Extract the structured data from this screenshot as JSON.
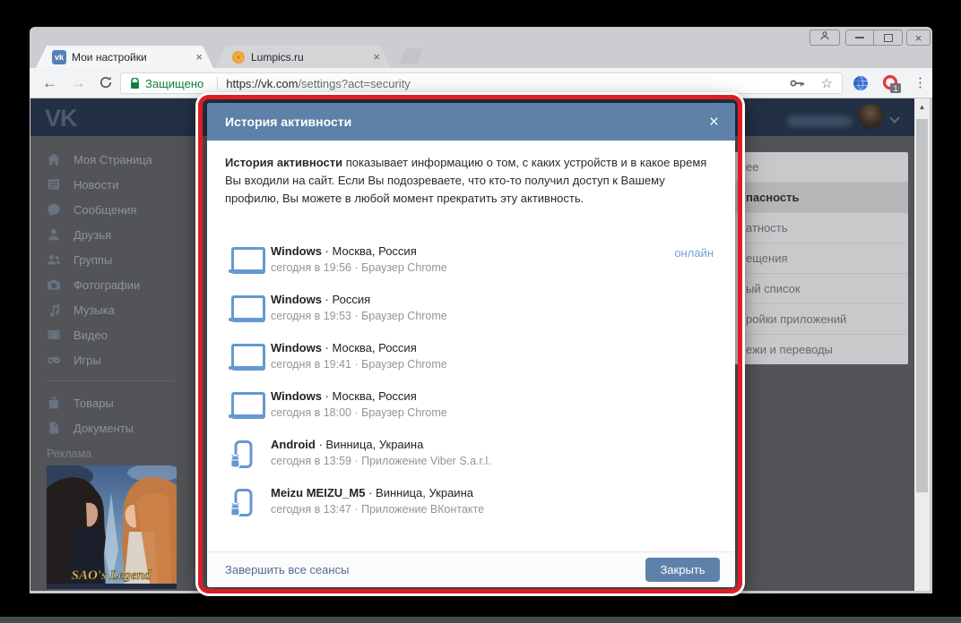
{
  "browser": {
    "tabs": [
      {
        "title": "Мои настройки",
        "favicon": "vk"
      },
      {
        "title": "Lumpics.ru",
        "favicon": "lumpics"
      }
    ],
    "security_label": "Защищено",
    "url_host": "https://vk.com",
    "url_path": "/settings?act=security",
    "extension_badge": "1"
  },
  "icons": {
    "back": "←",
    "forward": "→",
    "star": "☆",
    "menu_dots": "⋮",
    "tab_close": "×",
    "modal_close": "×",
    "window_close": "×",
    "scroll_up": "▲",
    "vk_favicon_text": "vk"
  },
  "vk": {
    "logo": "VK",
    "sidebar": [
      {
        "label": "Моя Страница"
      },
      {
        "label": "Новости"
      },
      {
        "label": "Сообщения"
      },
      {
        "label": "Друзья"
      },
      {
        "label": "Группы"
      },
      {
        "label": "Фотографии"
      },
      {
        "label": "Музыка"
      },
      {
        "label": "Видео"
      },
      {
        "label": "Игры"
      },
      {
        "label": "Товары"
      },
      {
        "label": "Документы"
      }
    ],
    "ads_label": "Реклама",
    "ad_title": "SAO's Legend",
    "settings_menu_visible": [
      {
        "label": "ее",
        "selected": false
      },
      {
        "label": "пасность",
        "selected": true
      },
      {
        "label": "атность",
        "selected": false
      },
      {
        "label": "ещения",
        "selected": false
      },
      {
        "label": "ый список",
        "selected": false
      },
      {
        "label": "ройки приложений",
        "selected": false
      },
      {
        "label": "ежи и переводы",
        "selected": false
      }
    ]
  },
  "modal": {
    "title": "История активности",
    "intro_bold": "История активности",
    "intro_text": " показывает информацию о том, с каких устройств и в какое время Вы входили на сайт. Если Вы подозреваете, что кто-то получил доступ к Вашему профилю, Вы можете в любой момент прекратить эту активность.",
    "separator": " · ",
    "sessions": [
      {
        "device": "Windows",
        "location": "Москва, Россия",
        "details": "сегодня в 19:56 · Браузер Chrome",
        "icon": "laptop",
        "status": "онлайн"
      },
      {
        "device": "Windows",
        "location": "Россия",
        "details": "сегодня в 19:53 · Браузер Chrome",
        "icon": "laptop",
        "status": ""
      },
      {
        "device": "Windows",
        "location": "Москва, Россия",
        "details": "сегодня в 19:41 · Браузер Chrome",
        "icon": "laptop",
        "status": ""
      },
      {
        "device": "Windows",
        "location": "Москва, Россия",
        "details": "сегодня в 18:00 · Браузер Chrome",
        "icon": "laptop",
        "status": ""
      },
      {
        "device": "Android",
        "location": "Винница, Украина",
        "details": "сегодня в 13:59 · Приложение Viber S.a.r.l.",
        "icon": "phone",
        "status": ""
      },
      {
        "device": "Meizu MEIZU_M5",
        "location": "Винница, Украина",
        "details": "сегодня в 13:47 · Приложение ВКонтакте",
        "icon": "phone",
        "status": ""
      }
    ],
    "terminate_link": "Завершить все сеансы",
    "close_button": "Закрыть"
  },
  "colors": {
    "modal_header": "#5d81a8",
    "button": "#5e81a9",
    "device_icon": "#6897d2",
    "online": "#76a2dc",
    "annotation_red": "#df1d24",
    "secure_green": "#108040",
    "vk_brand": "#5181b8"
  }
}
